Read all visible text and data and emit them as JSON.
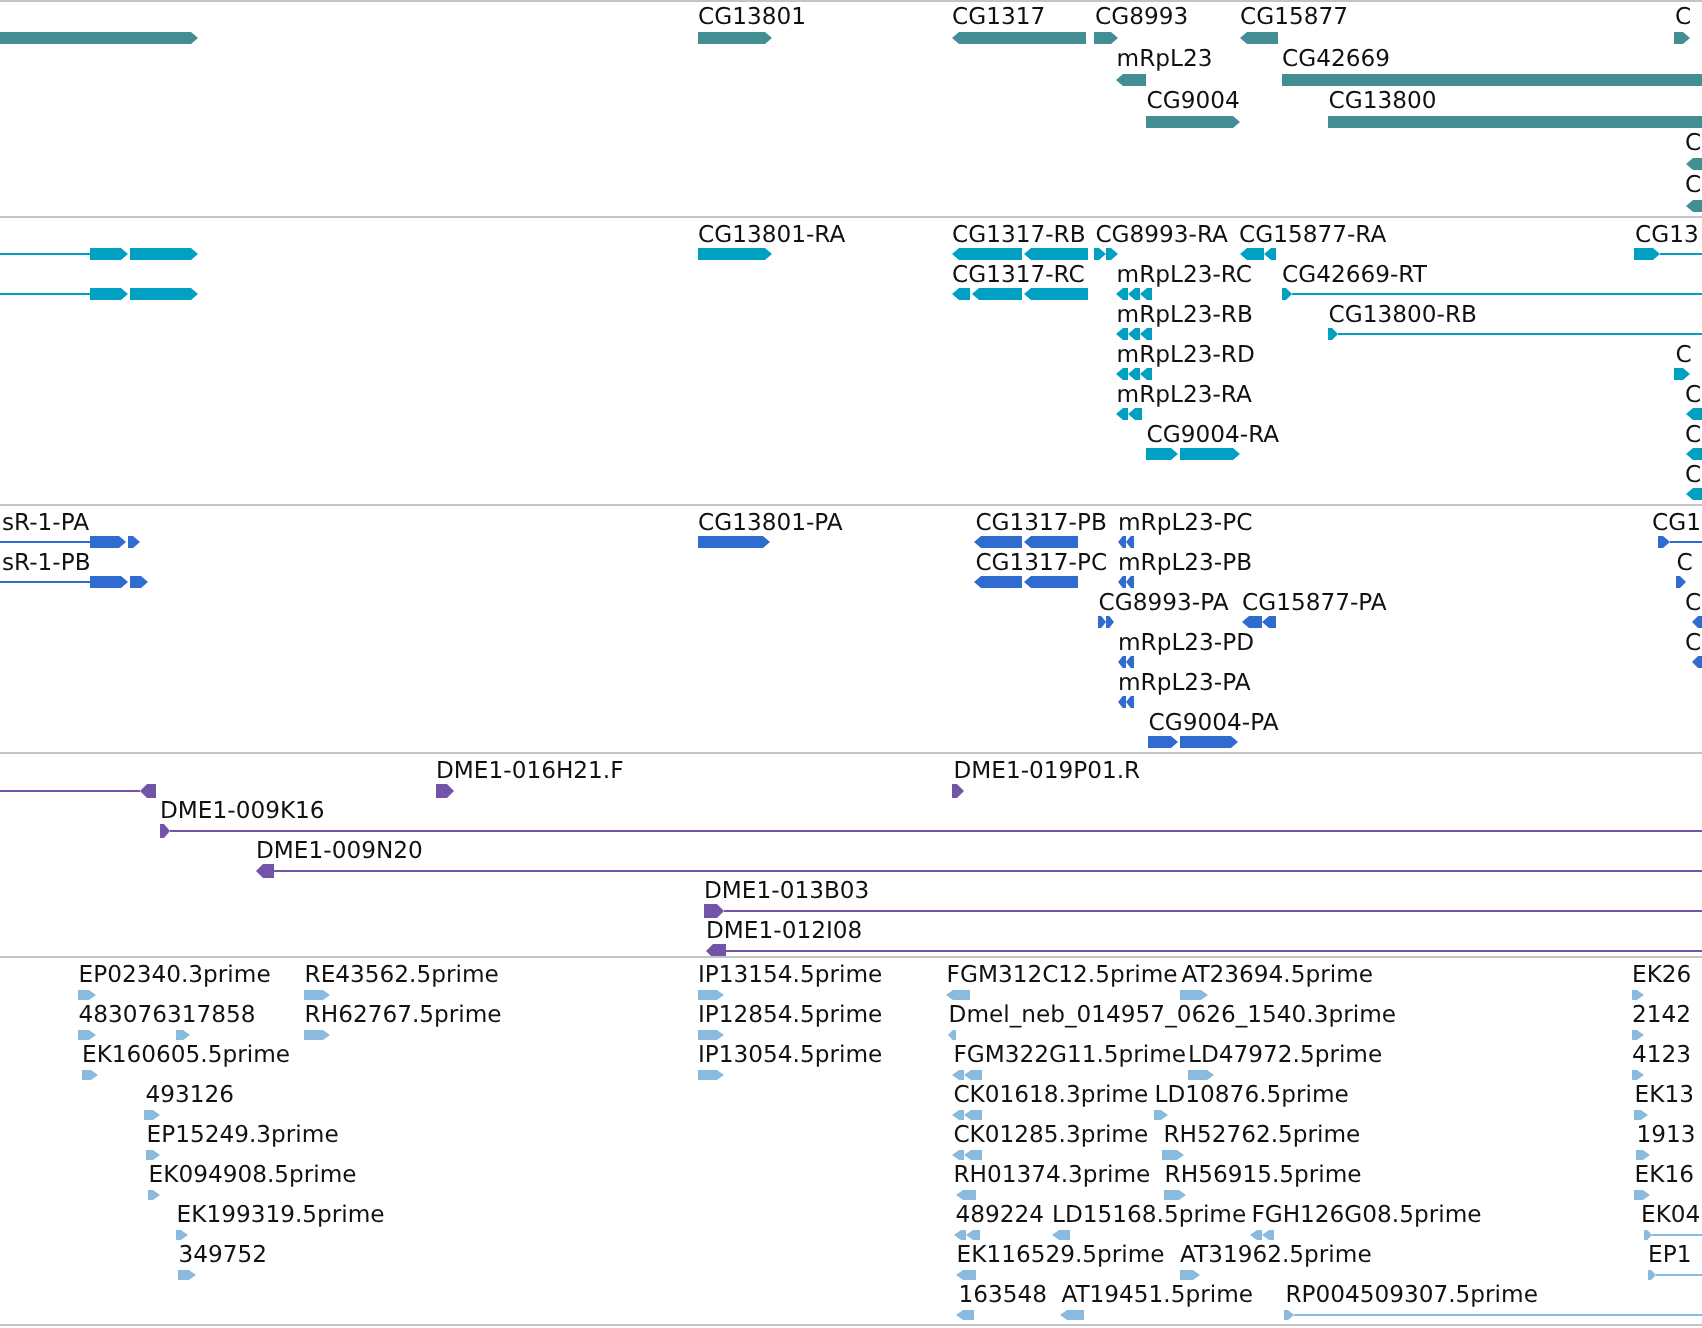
{
  "tracks": [
    {
      "color": "#428e92",
      "features": [
        {
          "kind": "forward"
        },
        {
          "label": "CG13801",
          "kind": "forward"
        },
        {
          "label": "CG1317",
          "kind": "reverse"
        },
        {
          "label": "CG8993",
          "kind": "forward"
        },
        {
          "label": "CG15877",
          "kind": "reverse"
        },
        {
          "label": "C",
          "kind": "forward"
        },
        {
          "label": "mRpL23",
          "kind": "reverse"
        },
        {
          "label": "CG42669",
          "kind": "bar"
        },
        {
          "label": "CG9004",
          "kind": "forward"
        },
        {
          "label": "CG13800",
          "kind": "bar"
        },
        {
          "label": "C",
          "kind": "reverse"
        },
        {
          "label": "C",
          "kind": "reverse"
        }
      ]
    },
    {
      "color": "#00a0c3",
      "features": [
        {
          "kind": "forward"
        },
        {
          "label": "CG13801-RA",
          "kind": "forward"
        },
        {
          "label": "CG1317-RB",
          "kind": "reverse"
        },
        {
          "label": "CG8993-RA",
          "kind": "forward"
        },
        {
          "label": "CG15877-RA",
          "kind": "reverse"
        },
        {
          "label": "CG13",
          "kind": "forward"
        },
        {
          "kind": "forward"
        },
        {
          "label": "CG1317-RC",
          "kind": "reverse"
        },
        {
          "label": "mRpL23-RC",
          "kind": "reverse"
        },
        {
          "label": "CG42669-RT",
          "kind": "forward"
        },
        {
          "label": "mRpL23-RB",
          "kind": "reverse"
        },
        {
          "label": "CG13800-RB",
          "kind": "forward"
        },
        {
          "label": "mRpL23-RD",
          "kind": "reverse"
        },
        {
          "label": "C",
          "kind": "forward"
        },
        {
          "label": "mRpL23-RA",
          "kind": "reverse"
        },
        {
          "label": "C",
          "kind": "reverse"
        },
        {
          "label": "CG9004-RA",
          "kind": "forward"
        },
        {
          "label": "C",
          "kind": "reverse"
        },
        {
          "label": "C",
          "kind": "reverse"
        }
      ]
    },
    {
      "color": "#306bd0",
      "features": [
        {
          "label": "sR-1-PA",
          "kind": "forward"
        },
        {
          "label": "CG13801-PA",
          "kind": "forward"
        },
        {
          "label": "CG1317-PB",
          "kind": "reverse"
        },
        {
          "label": "mRpL23-PC",
          "kind": "reverse"
        },
        {
          "label": "CG1",
          "kind": "forward"
        },
        {
          "label": "sR-1-PB",
          "kind": "forward"
        },
        {
          "label": "CG1317-PC",
          "kind": "reverse"
        },
        {
          "label": "mRpL23-PB",
          "kind": "reverse"
        },
        {
          "label": "C",
          "kind": "forward"
        },
        {
          "label": "CG8993-PA",
          "kind": "forward"
        },
        {
          "label": "CG15877-PA",
          "kind": "reverse"
        },
        {
          "label": "C",
          "kind": "reverse"
        },
        {
          "label": "mRpL23-PD",
          "kind": "reverse"
        },
        {
          "label": "C",
          "kind": "reverse"
        },
        {
          "label": "mRpL23-PA",
          "kind": "reverse"
        },
        {
          "label": "CG9004-PA",
          "kind": "forward"
        }
      ]
    },
    {
      "color": "#7255a8",
      "features": [
        {
          "kind": "reverse"
        },
        {
          "label": "DME1-016H21.F",
          "kind": "forward"
        },
        {
          "label": "DME1-019P01.R",
          "kind": "forward"
        },
        {
          "label": "DME1-009K16",
          "kind": "forward"
        },
        {
          "label": "DME1-009N20",
          "kind": "reverse"
        },
        {
          "label": "DME1-013B03",
          "kind": "forward"
        },
        {
          "label": "DME1-012I08",
          "kind": "reverse"
        }
      ]
    },
    {
      "color": "#8abadd",
      "features": [
        {
          "label": "EP02340.3prime",
          "kind": "forward"
        },
        {
          "label": "RE43562.5prime",
          "kind": "forward"
        },
        {
          "label": "IP13154.5prime",
          "kind": "forward"
        },
        {
          "label": "FGM312C12.5prime",
          "kind": "reverse"
        },
        {
          "label": "AT23694.5prime",
          "kind": "forward"
        },
        {
          "label": "EK26",
          "kind": "forward"
        },
        {
          "label": "483076317858",
          "kind": "forward"
        },
        {
          "kind": "forward"
        },
        {
          "label": "RH62767.5prime",
          "kind": "forward"
        },
        {
          "label": "IP12854.5prime",
          "kind": "forward"
        },
        {
          "label": "Dmel_neb_014957_0626_1540.3prime",
          "kind": "reverse"
        },
        {
          "label": "2142",
          "kind": "forward"
        },
        {
          "label": "EK160605.5prime",
          "kind": "forward"
        },
        {
          "label": "IP13054.5prime",
          "kind": "forward"
        },
        {
          "label": "FGM322G11.5prime",
          "kind": "reverse"
        },
        {
          "label": "LD47972.5prime",
          "kind": "forward"
        },
        {
          "label": "4123",
          "kind": "forward"
        },
        {
          "label": "493126",
          "kind": "forward"
        },
        {
          "label": "CK01618.3prime",
          "kind": "reverse"
        },
        {
          "label": "LD10876.5prime",
          "kind": "forward"
        },
        {
          "label": "EK13",
          "kind": "forward"
        },
        {
          "label": "EP15249.3prime",
          "kind": "forward"
        },
        {
          "label": "CK01285.3prime",
          "kind": "reverse"
        },
        {
          "label": "RH52762.5prime",
          "kind": "forward"
        },
        {
          "label": "1913",
          "kind": "forward"
        },
        {
          "label": "EK094908.5prime",
          "kind": "forward"
        },
        {
          "label": "RH01374.3prime",
          "kind": "reverse"
        },
        {
          "label": "RH56915.5prime",
          "kind": "forward"
        },
        {
          "label": "EK16",
          "kind": "forward"
        },
        {
          "label": "EK199319.5prime",
          "kind": "forward"
        },
        {
          "label": "489224",
          "kind": "reverse"
        },
        {
          "label": "LD15168.5prime",
          "kind": "reverse"
        },
        {
          "label": "FGH126G08.5prime",
          "kind": "reverse"
        },
        {
          "label": "EK04",
          "kind": "forward"
        },
        {
          "label": "349752",
          "kind": "forward"
        },
        {
          "label": "EK116529.5prime",
          "kind": "reverse"
        },
        {
          "label": "AT31962.5prime",
          "kind": "forward"
        },
        {
          "label": "EP1",
          "kind": "forward"
        },
        {
          "label": "163548",
          "kind": "reverse"
        },
        {
          "label": "AT19451.5prime",
          "kind": "reverse"
        },
        {
          "label": "RP004509307.5prime",
          "kind": "forward"
        }
      ]
    }
  ]
}
